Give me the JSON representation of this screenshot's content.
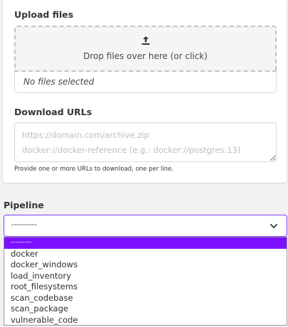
{
  "upload": {
    "heading": "Upload files",
    "icon": "upload-icon",
    "drop_text": "Drop files over here (or click)",
    "file_status": "No files selected"
  },
  "download": {
    "heading": "Download URLs",
    "placeholder": "https://domain.com/archive.zip\ndocker://docker-reference (e.g.: docker://postgres:13)",
    "value": "",
    "help": "Provide one or more URLs to download, one per line."
  },
  "pipeline": {
    "heading": "Pipeline",
    "selected_value": "---------",
    "options": [
      "---------",
      "docker",
      "docker_windows",
      "load_inventory",
      "root_filesystems",
      "scan_codebase",
      "scan_package",
      "vulnerable_code"
    ],
    "selected_index": 0
  },
  "colors": {
    "accent": "#7c10ff",
    "focus_border": "#7d3cff",
    "page_bg": "#f2f2f2",
    "card_bg": "#ffffff"
  }
}
